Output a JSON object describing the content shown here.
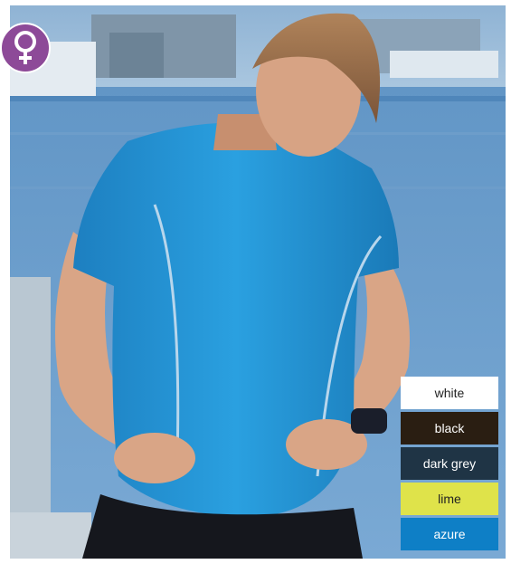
{
  "gender_icon": "female-symbol-icon",
  "colors": {
    "badge_bg": "#8d4a98",
    "shirt": "#1f8ed0"
  },
  "swatches": [
    {
      "label": "white",
      "bg": "#ffffff",
      "fg": "#222222"
    },
    {
      "label": "black",
      "bg": "#2a1e12",
      "fg": "#ffffff"
    },
    {
      "label": "dark grey",
      "bg": "#1f3445",
      "fg": "#ffffff"
    },
    {
      "label": "lime",
      "bg": "#dfe34a",
      "fg": "#222222"
    },
    {
      "label": "azure",
      "bg": "#0e7fc6",
      "fg": "#ffffff"
    }
  ]
}
